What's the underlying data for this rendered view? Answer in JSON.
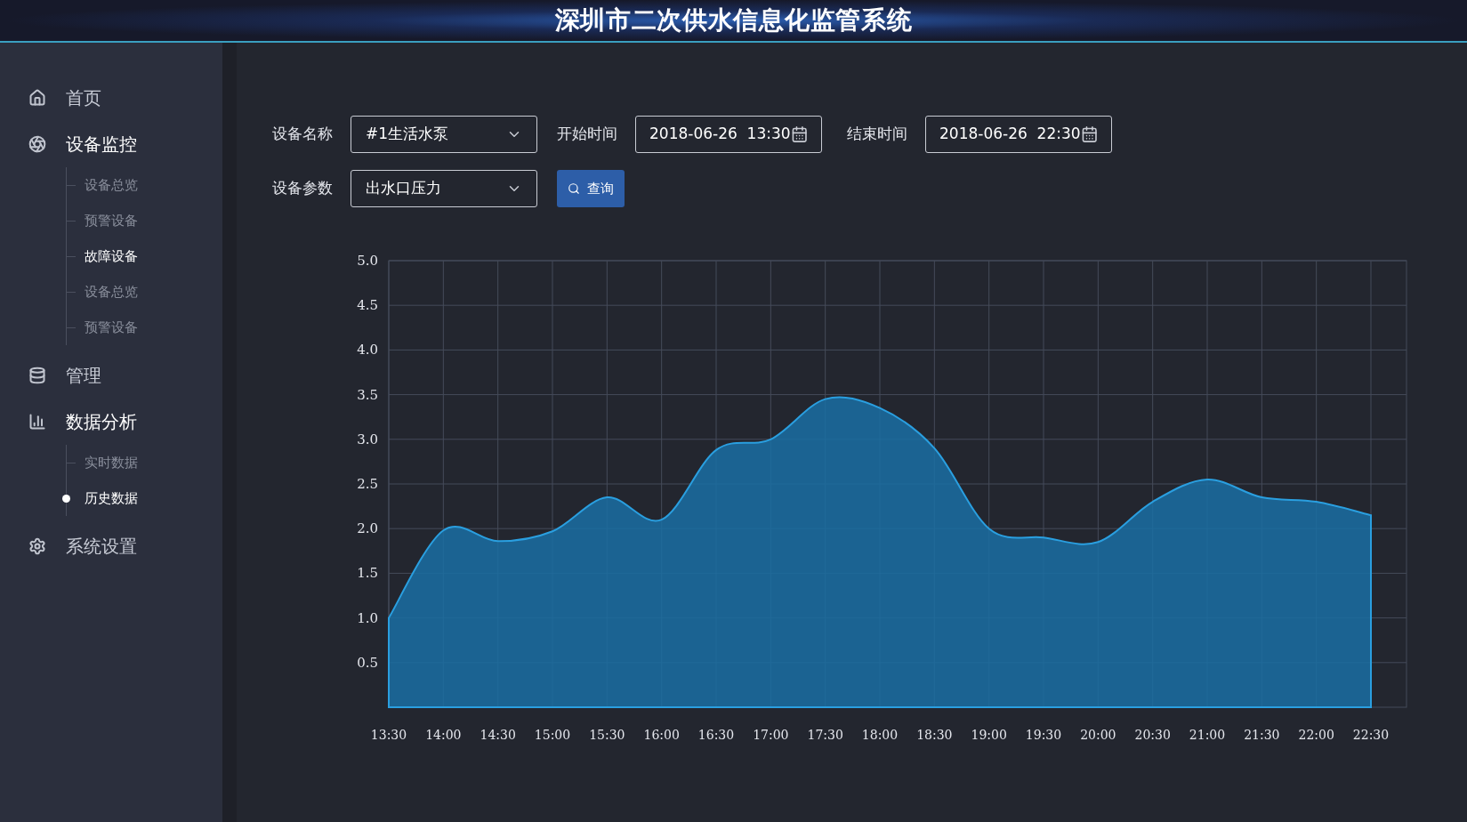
{
  "header": {
    "title": "深圳市二次供水信息化监管系统"
  },
  "sidebar": {
    "items": [
      {
        "label": "首页",
        "expanded": false
      },
      {
        "label": "设备监控",
        "expanded": true,
        "children": [
          {
            "label": "设备总览",
            "selected": false,
            "highlighted": false
          },
          {
            "label": "预警设备",
            "selected": false,
            "highlighted": false
          },
          {
            "label": "故障设备",
            "selected": false,
            "highlighted": true
          },
          {
            "label": "设备总览",
            "selected": false,
            "highlighted": false
          },
          {
            "label": "预警设备",
            "selected": false,
            "highlighted": false
          }
        ]
      },
      {
        "label": "管理",
        "expanded": false
      },
      {
        "label": "数据分析",
        "expanded": true,
        "children": [
          {
            "label": "实时数据",
            "selected": false,
            "highlighted": false
          },
          {
            "label": "历史数据",
            "selected": true,
            "highlighted": true
          }
        ]
      },
      {
        "label": "系统设置",
        "expanded": false
      }
    ]
  },
  "filters": {
    "device_name": {
      "label": "设备名称",
      "value": "#1生活水泵"
    },
    "start_time": {
      "label": "开始时间",
      "value": "2018-06-26  13:30"
    },
    "end_time": {
      "label": "结束时间",
      "value": "2018-06-26  22:30"
    },
    "parameter": {
      "label": "设备参数",
      "value": "出水口压力"
    },
    "query_button": "查询"
  },
  "chart": {
    "chart_data": {
      "type": "area",
      "categories": [
        "13:30",
        "14:00",
        "14:30",
        "15:00",
        "15:30",
        "16:00",
        "16:30",
        "17:00",
        "17:30",
        "18:00",
        "18:30",
        "19:00",
        "19:30",
        "20:00",
        "20:30",
        "21:00",
        "21:30",
        "22:00",
        "22:30"
      ],
      "grid": true,
      "series": [
        {
          "color": "#1a6fa3",
          "values": [
            1.0,
            1.98,
            1.86,
            1.97,
            2.35,
            2.1,
            2.88,
            3.0,
            3.45,
            3.35,
            2.9,
            2.0,
            1.9,
            1.85,
            2.3,
            2.55,
            2.35,
            2.3,
            2.15
          ]
        }
      ],
      "ylim": [
        0,
        5
      ],
      "yticks": [
        {
          "value": 0.5,
          "label": "0.5"
        },
        {
          "value": 1,
          "label": "1.0"
        },
        {
          "value": 1.5,
          "label": "1.5"
        },
        {
          "value": 2,
          "label": "2.0"
        },
        {
          "value": 2.5,
          "label": "2.5"
        },
        {
          "value": 3,
          "label": "3.0"
        },
        {
          "value": 3.5,
          "label": "3.5"
        },
        {
          "value": 4,
          "label": "4.0"
        },
        {
          "value": 4.5,
          "label": "4.5"
        },
        {
          "value": 5,
          "label": "5.0"
        }
      ]
    }
  }
}
